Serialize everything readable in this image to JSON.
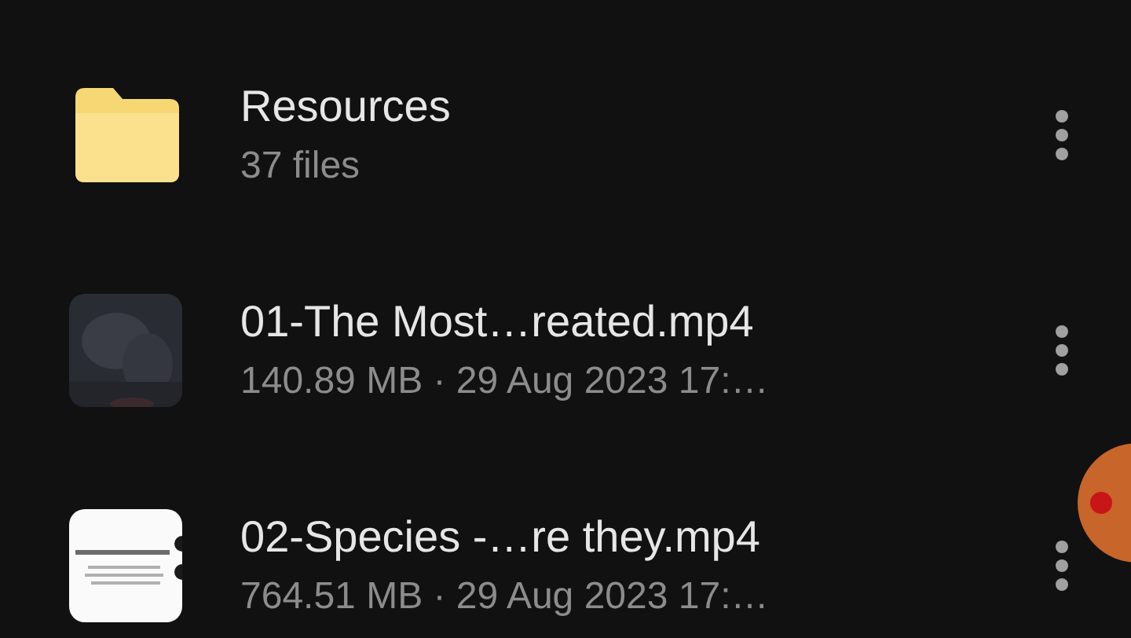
{
  "files": [
    {
      "kind": "folder",
      "name": "Resources",
      "details": "37 files"
    },
    {
      "kind": "video",
      "name": "01-The Most…reated.mp4",
      "details": "140.89 MB · 29 Aug 2023 17:…"
    },
    {
      "kind": "video",
      "name": "02-Species -…re they.mp4",
      "details": "764.51 MB · 29 Aug 2023 17:…"
    }
  ]
}
